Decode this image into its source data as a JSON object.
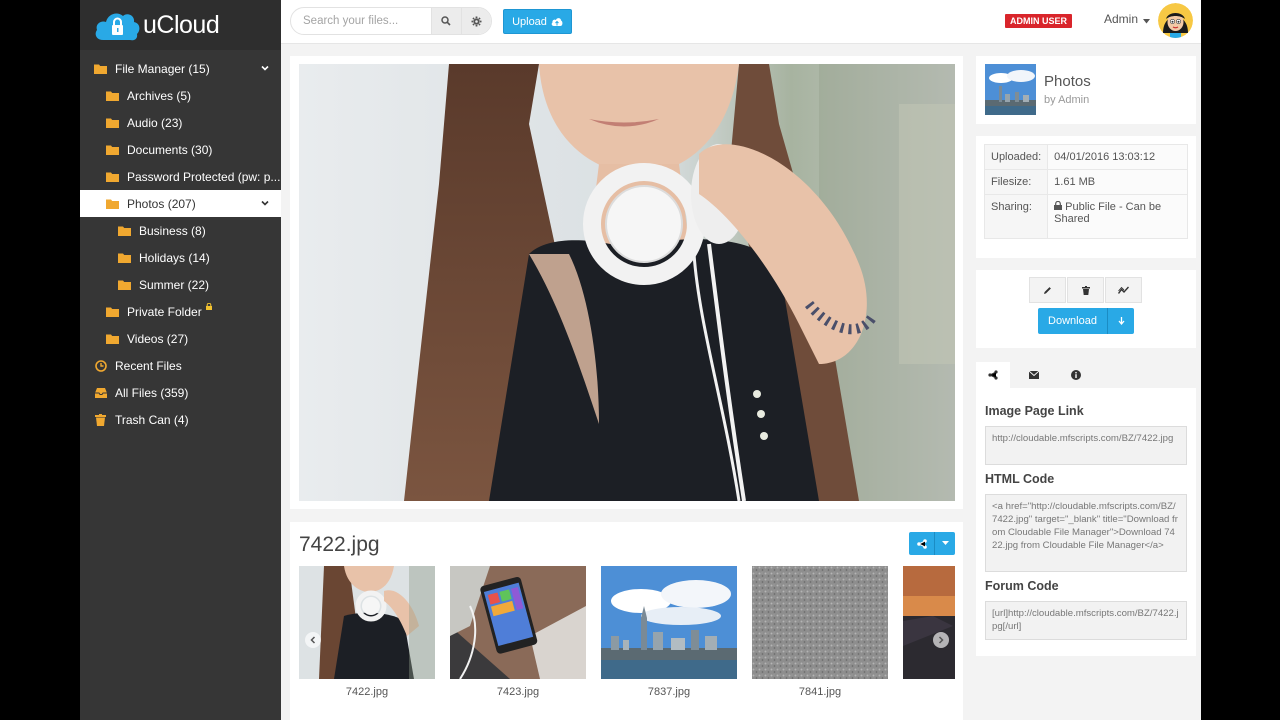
{
  "app": {
    "name": "uCloud"
  },
  "sidebar": {
    "items": [
      {
        "label": "File Manager (15)",
        "icon": "folder-icon"
      },
      {
        "label": "Archives (5)",
        "icon": "folder-icon"
      },
      {
        "label": "Audio (23)",
        "icon": "folder-icon"
      },
      {
        "label": "Documents (30)",
        "icon": "folder-icon"
      },
      {
        "label": "Password Protected (pw: p...",
        "icon": "folder-icon"
      },
      {
        "label": "Photos (207)",
        "icon": "folder-icon"
      },
      {
        "label": "Business (8)",
        "icon": "folder-icon"
      },
      {
        "label": "Holidays (14)",
        "icon": "folder-icon"
      },
      {
        "label": "Summer (22)",
        "icon": "folder-icon"
      },
      {
        "label": "Private Folder",
        "icon": "folder-icon"
      },
      {
        "label": "Videos (27)",
        "icon": "folder-icon"
      },
      {
        "label": "Recent Files",
        "icon": "clock-icon"
      },
      {
        "label": "All Files (359)",
        "icon": "inbox-icon"
      },
      {
        "label": "Trash Can (4)",
        "icon": "trash-icon"
      }
    ]
  },
  "header": {
    "search_placeholder": "Search your files...",
    "upload_label": "Upload",
    "admin_badge": "ADMIN USER",
    "user_name": "Admin"
  },
  "file": {
    "name": "7422.jpg",
    "folder": "Photos",
    "owner": "by Admin"
  },
  "meta": {
    "uploaded_label": "Uploaded:",
    "uploaded_value": "04/01/2016 13:03:12",
    "filesize_label": "Filesize:",
    "filesize_value": "1.61 MB",
    "sharing_label": "Sharing:",
    "sharing_value": "Public File - Can be Shared"
  },
  "actions": {
    "download_label": "Download"
  },
  "thumbnails": [
    {
      "caption": "7422.jpg"
    },
    {
      "caption": "7423.jpg"
    },
    {
      "caption": "7837.jpg"
    },
    {
      "caption": "7841.jpg"
    },
    {
      "caption": "7"
    }
  ],
  "codes": {
    "image_link_label": "Image Page Link",
    "image_link_value": "http://cloudable.mfscripts.com/BZ/7422.jpg",
    "html_code_label": "HTML Code",
    "html_code_value": "<a href=\"http://cloudable.mfscripts.com/BZ/7422.jpg\" target=\"_blank\" title=\"Download from Cloudable File Manager\">Download 7422.jpg from Cloudable File Manager</a>",
    "forum_code_label": "Forum Code",
    "forum_code_value": "[url]http://cloudable.mfscripts.com/BZ/7422.jpg[/url]"
  },
  "colors": {
    "accent": "#29a9e6",
    "sidebar": "#363636",
    "folder": "#f0a830",
    "badge": "#d9252b"
  }
}
